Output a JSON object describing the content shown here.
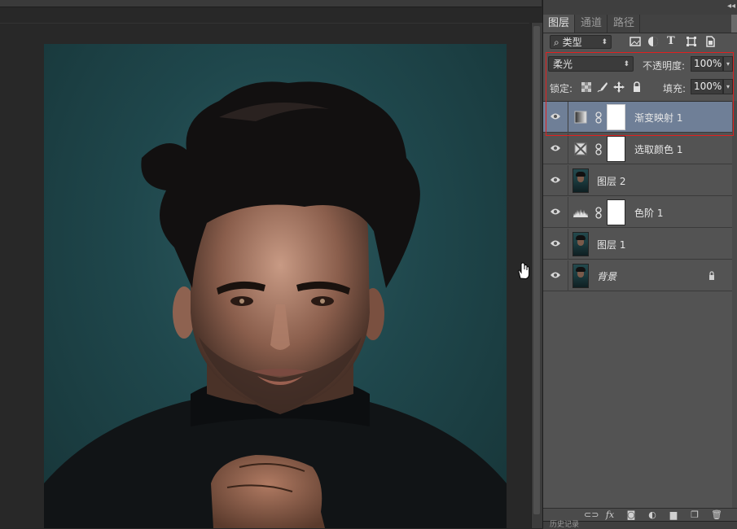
{
  "panel": {
    "tabs": [
      {
        "label": "图层",
        "active": true
      },
      {
        "label": "通道",
        "active": false
      },
      {
        "label": "路径",
        "active": false
      }
    ],
    "filter": {
      "label": "类型",
      "icons": [
        "image-filter-icon",
        "adjustment-filter-icon",
        "type-filter-icon",
        "shape-filter-icon",
        "smart-object-filter-icon"
      ]
    },
    "blend_mode": "柔光",
    "opacity_label": "不透明度:",
    "opacity_value": "100%",
    "lock_label": "锁定:",
    "fill_label": "填充:",
    "fill_value": "100%",
    "layers": [
      {
        "name": "渐变映射 1",
        "kind": "gradient-map",
        "selected": true
      },
      {
        "name": "选取颜色 1",
        "kind": "selective-color",
        "selected": false
      },
      {
        "name": "图层 2",
        "kind": "photo",
        "selected": false
      },
      {
        "name": "色阶 1",
        "kind": "levels",
        "selected": false
      },
      {
        "name": "图层 1",
        "kind": "photo",
        "selected": false
      },
      {
        "name": "背景",
        "kind": "background",
        "selected": false,
        "locked": true
      }
    ],
    "next_panel_title": "历史记录"
  },
  "colors": {
    "selected_row": "#6f7f97",
    "highlight_box": "#e02020",
    "canvas_background": "#1f474c"
  }
}
